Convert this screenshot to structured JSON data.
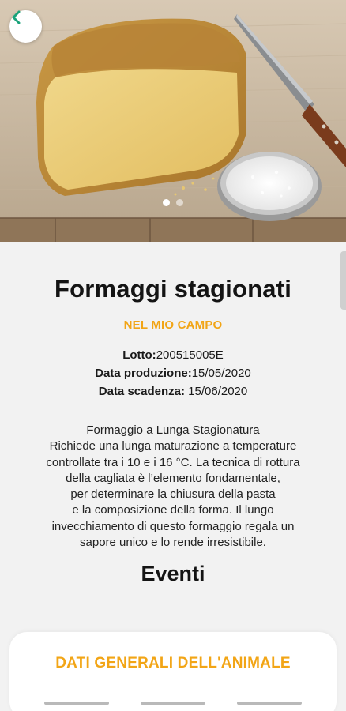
{
  "colors": {
    "accent": "#f2a516",
    "back_icon": "#1aa37a",
    "background": "#f2f2f2"
  },
  "hero": {
    "image": "cheese wheel with knife and salt bowl on linen",
    "slide_index": 1,
    "slide_count": 2
  },
  "header": {
    "back_icon": "chevron-left-icon"
  },
  "product": {
    "title": "Formaggi stagionati",
    "subtitle": "NEL MIO CAMPO",
    "lot_label": "Lotto:",
    "lot_value": "200515005E",
    "prod_label": "Data produzione:",
    "prod_value": "15/05/2020",
    "exp_label": "Data scadenza:",
    "exp_value": " 15/06/2020",
    "description": [
      "Formaggio a Lunga Stagionatura",
      "Richiede una lunga maturazione a temperature",
      "controllate tra i 10 e i 16 °C. La tecnica di rottura",
      "della cagliata è l’elemento fondamentale,",
      "per determinare la chiusura della pasta",
      "e la composizione della forma. Il lungo",
      "invecchiamento di questo formaggio regala un",
      "sapore unico e lo rende irresistibile."
    ]
  },
  "events": {
    "title": "Eventi"
  },
  "card": {
    "label": "DATI GENERALI DELL'ANIMALE"
  }
}
